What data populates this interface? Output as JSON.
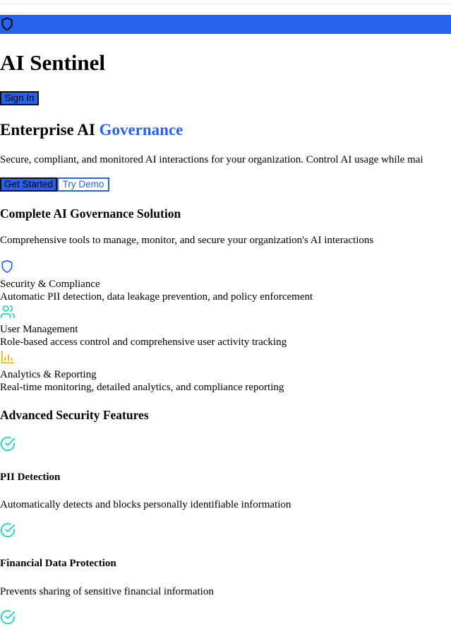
{
  "brand": {
    "name": "AI Sentinel"
  },
  "nav": {
    "signin_label": "Sign In"
  },
  "hero": {
    "title_prefix": "Enterprise AI",
    "title_accent": "Governance",
    "description": "Secure, compliant, and monitored AI interactions for your organization. Control AI usage while mai",
    "get_started_label": "Get Started",
    "try_demo_label": "Try Demo"
  },
  "solution": {
    "title": "Complete AI Governance Solution",
    "description": "Comprehensive tools to manage, monitor, and secure your organization's AI interactions",
    "features": [
      {
        "icon": "shield-icon",
        "title": "Security & Compliance",
        "description": "Automatic PII detection, data leakage prevention, and policy enforcement"
      },
      {
        "icon": "users-icon",
        "title": "User Management",
        "description": "Role-based access control and comprehensive user activity tracking"
      },
      {
        "icon": "bar-chart-icon",
        "title": "Analytics & Reporting",
        "description": "Real-time monitoring, detailed analytics, and compliance reporting"
      }
    ]
  },
  "advanced": {
    "title": "Advanced Security Features",
    "items": [
      {
        "icon": "check-circle-icon",
        "title": "PII Detection",
        "description": "Automatically detects and blocks personally identifiable information"
      },
      {
        "icon": "check-circle-icon",
        "title": "Financial Data Protection",
        "description": "Prevents sharing of sensitive financial information"
      },
      {
        "icon": "check-circle-icon"
      }
    ]
  },
  "colors": {
    "primary": "#2563eb",
    "accent_teal": "#2dd4bf",
    "accent_amber": "#eab308"
  }
}
